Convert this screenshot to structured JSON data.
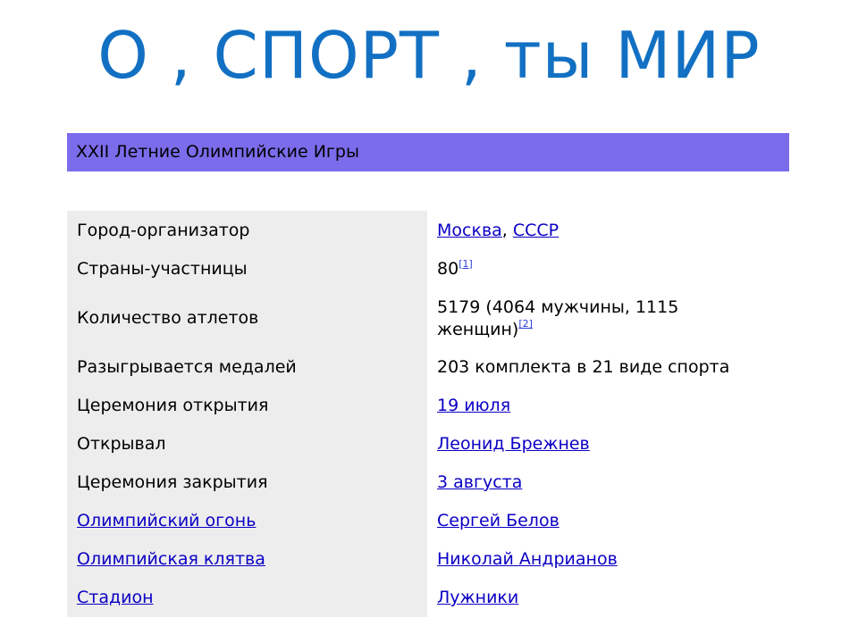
{
  "title": "О , СПОРТ , ты МИР",
  "header": "XXII Летние Олимпийские Игры",
  "rows": [
    {
      "label": "Город-организатор",
      "v1": "Москва",
      "sep": ", ",
      "v2": "СССР"
    },
    {
      "label": "Страны-участницы",
      "value": "80",
      "ref": "[1]"
    },
    {
      "label": "Количество атлетов",
      "value_line1": "5179 (4064 мужчины, 1115",
      "value_line2": "женщин)",
      "ref": "[2]"
    },
    {
      "label": "Разыгрывается медалей",
      "value": "203 комплекта в 21 виде спорта"
    },
    {
      "label": "Церемония открытия",
      "value": "19 июля"
    },
    {
      "label": "Открывал",
      "value": "Леонид Брежнев"
    },
    {
      "label": "Церемония закрытия",
      "value": "3 августа"
    },
    {
      "label": "Олимпийский огонь",
      "value": "Сергей Белов"
    },
    {
      "label": "Олимпийская клятва",
      "value": "Николай Андрианов"
    },
    {
      "label": "Стадион",
      "value": "Лужники"
    }
  ]
}
